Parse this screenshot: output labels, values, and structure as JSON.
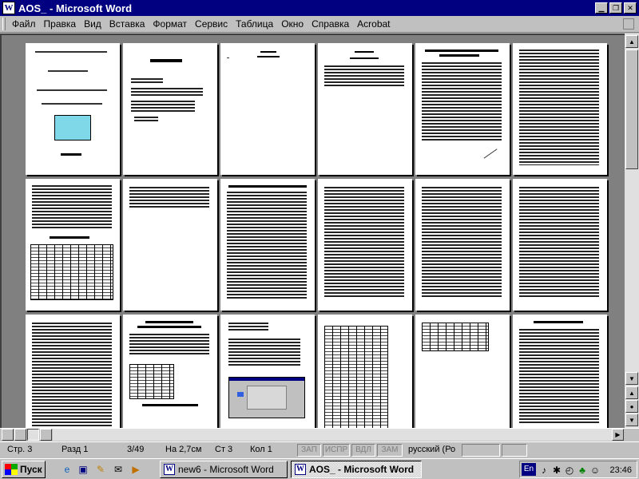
{
  "window": {
    "title": "AOS_ - Microsoft Word",
    "app_icon": "W",
    "buttons": {
      "minimize_icon": "minimize-icon",
      "maximize_icon": "restore-icon",
      "close_icon": "close-icon"
    }
  },
  "menu": {
    "items": [
      {
        "label": "Файл"
      },
      {
        "label": "Правка"
      },
      {
        "label": "Вид"
      },
      {
        "label": "Вставка"
      },
      {
        "label": "Формат"
      },
      {
        "label": "Сервис"
      },
      {
        "label": "Таблица"
      },
      {
        "label": "Окно"
      },
      {
        "label": "Справка"
      },
      {
        "label": "Acrobat"
      }
    ]
  },
  "status": {
    "page": "Стр. 3",
    "section": "Разд 1",
    "page_of": "3/49",
    "at": "На 2,7см",
    "line": "Ст 3",
    "column": "Кол 1",
    "rec": "ЗАП",
    "trk": "ИСПР",
    "ext": "ВДЛ",
    "ovr": "ЗАМ",
    "language": "русский (Ро"
  },
  "taskbar": {
    "start_label": "Пуск",
    "tasks": [
      {
        "label": "new6 - Microsoft Word"
      },
      {
        "label": "AOS_ - Microsoft Word"
      }
    ],
    "tray": {
      "language": "En",
      "clock": "23:46"
    }
  },
  "colors": {
    "titlebar": "#000080",
    "chrome": "#c0c0c0",
    "workspace": "#808080"
  }
}
